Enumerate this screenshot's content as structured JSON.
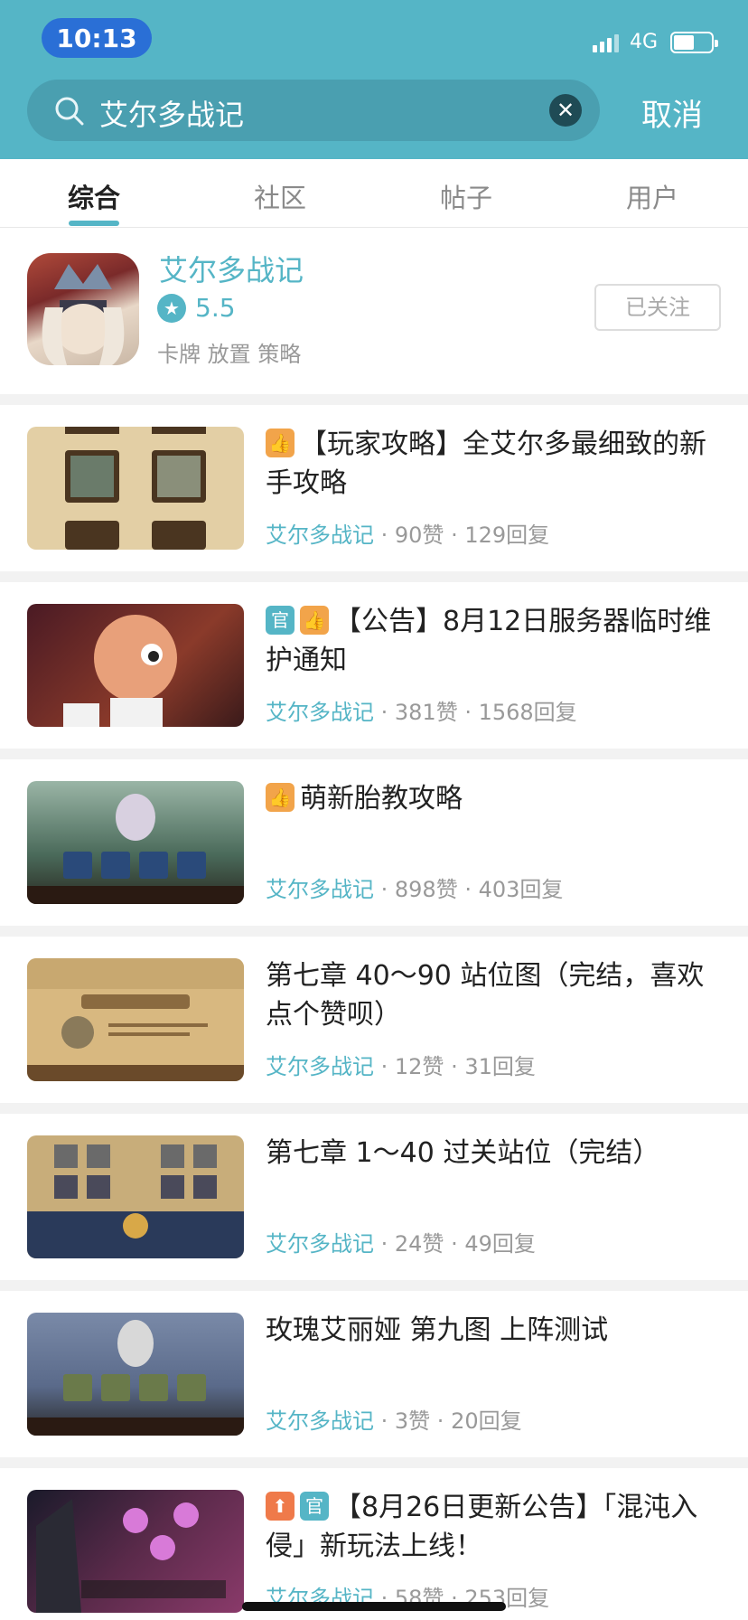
{
  "status": {
    "time": "10:13",
    "network": "4G",
    "battery_level": 0.55
  },
  "search": {
    "query": "艾尔多战记",
    "clear_icon": "✕",
    "cancel_label": "取消"
  },
  "tabs": [
    {
      "label": "综合",
      "active": true
    },
    {
      "label": "社区",
      "active": false
    },
    {
      "label": "帖子",
      "active": false
    },
    {
      "label": "用户",
      "active": false
    }
  ],
  "app": {
    "name": "艾尔多战记",
    "rating": "5.5",
    "tags": "卡牌 放置 策略",
    "follow_label": "已关注"
  },
  "posts": [
    {
      "title": "【玩家攻略】全艾尔多最细致的新手攻略",
      "badges": [
        "good"
      ],
      "source": "艾尔多战记",
      "likes": "90赞",
      "replies": "129回复"
    },
    {
      "title": "【公告】8月12日服务器临时维护通知",
      "badges": [
        "off",
        "good"
      ],
      "source": "艾尔多战记",
      "likes": "381赞",
      "replies": "1568回复"
    },
    {
      "title": "萌新胎教攻略",
      "badges": [
        "good"
      ],
      "source": "艾尔多战记",
      "likes": "898赞",
      "replies": "403回复"
    },
    {
      "title": "第七章 40～90 站位图（完结，喜欢点个赞呗）",
      "badges": [],
      "source": "艾尔多战记",
      "likes": "12赞",
      "replies": "31回复"
    },
    {
      "title": "第七章 1～40 过关站位（完结）",
      "badges": [],
      "source": "艾尔多战记",
      "likes": "24赞",
      "replies": "49回复"
    },
    {
      "title": "玫瑰艾丽娅 第九图 上阵测试",
      "badges": [],
      "source": "艾尔多战记",
      "likes": "3赞",
      "replies": "20回复"
    },
    {
      "title": "【8月26日更新公告】「混沌入侵」新玩法上线！",
      "badges": [
        "up",
        "off"
      ],
      "source": "艾尔多战记",
      "likes": "58赞",
      "replies": "253回复"
    }
  ],
  "badge_glyphs": {
    "good": "👍",
    "off": "官",
    "up": "⬆"
  },
  "colors": {
    "header": "#55b5c6",
    "accent": "#55b5c6",
    "time_pill": "#2a6fd6"
  }
}
